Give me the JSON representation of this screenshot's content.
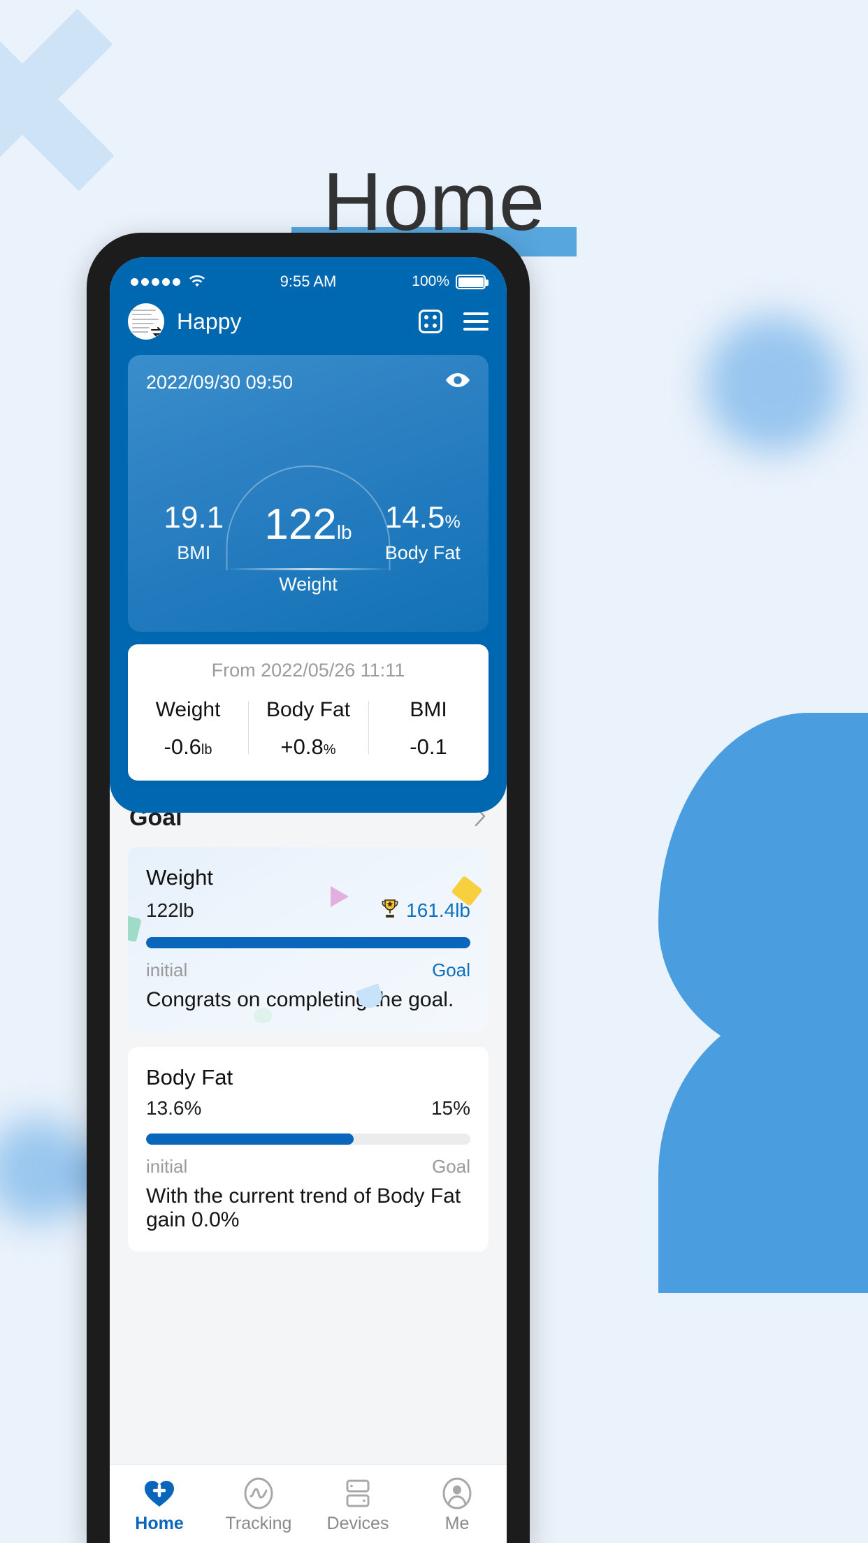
{
  "page": {
    "title": "Home"
  },
  "status_bar": {
    "signal_dots": 5,
    "wifi_icon": "wifi-icon",
    "time": "9:55 AM",
    "battery_percent": "100%",
    "battery_icon": "battery-full-icon"
  },
  "app_header": {
    "avatar_icon": "avatar",
    "avatar_badge_icon": "switch-user-icon",
    "username": "Happy",
    "scan_icon": "dice-scan-icon",
    "menu_icon": "hamburger-menu-icon"
  },
  "measurement": {
    "datetime": "2022/09/30 09:50",
    "eye_icon": "eye-icon",
    "bmi": {
      "value": "19.1",
      "unit": "",
      "label": "BMI"
    },
    "weight": {
      "value": "122",
      "unit": "lb",
      "label": "Weight"
    },
    "body_fat": {
      "value": "14.5",
      "unit": "%",
      "label": "Body Fat"
    }
  },
  "comparison": {
    "from_label": "From 2022/05/26 11:11",
    "items": [
      {
        "label": "Weight",
        "delta": "-0.6",
        "unit": "lb"
      },
      {
        "label": "Body Fat",
        "delta": "+0.8",
        "unit": "%"
      },
      {
        "label": "BMI",
        "delta": "-0.1",
        "unit": ""
      }
    ]
  },
  "goal_section": {
    "title": "Goal",
    "chevron_icon": "chevron-right-icon",
    "cards": [
      {
        "title": "Weight",
        "current": "122lb",
        "target": "161.4lb",
        "trophy_icon": "trophy-icon",
        "progress_percent": 100,
        "initial_label": "initial",
        "goal_label": "Goal",
        "message": "Congrats on completing the goal."
      },
      {
        "title": "Body Fat",
        "current": "13.6%",
        "target": "15%",
        "progress_percent": 64,
        "initial_label": "initial",
        "goal_label": "Goal",
        "message": "With the current trend of Body Fat gain 0.0%"
      }
    ]
  },
  "tab_bar": {
    "items": [
      {
        "label": "Home",
        "icon": "heart-plus-icon",
        "active": true
      },
      {
        "label": "Tracking",
        "icon": "pulse-circle-icon",
        "active": false
      },
      {
        "label": "Devices",
        "icon": "devices-icon",
        "active": false
      },
      {
        "label": "Me",
        "icon": "person-circle-icon",
        "active": false
      }
    ]
  },
  "theme": {
    "brand_blue": "#0067b1",
    "accent_blue": "#0a66ba",
    "page_bg": "#eaf2fb",
    "title_highlight": "#57a6de"
  }
}
